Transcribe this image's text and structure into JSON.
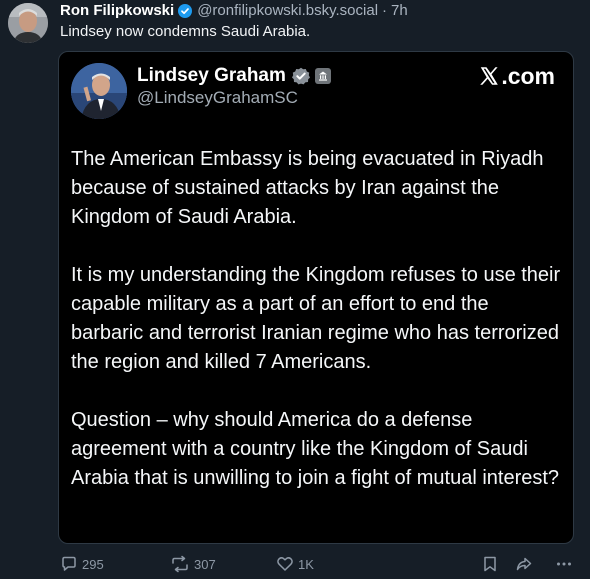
{
  "post": {
    "author_name": "Ron Filipkowski",
    "author_handle": "@ronfilipkowski.bsky.social",
    "separator": "·",
    "time": "7h",
    "text": "Lindsey now condemns Saudi Arabia."
  },
  "embed": {
    "name": "Lindsey Graham",
    "handle": "@LindseyGrahamSC",
    "source": ".com",
    "paragraphs": [
      "The American Embassy is being evacuated in Riyadh because of sustained attacks by Iran against the Kingdom of Saudi Arabia.",
      "It is my understanding the Kingdom refuses to use their capable military as a part of an effort to end the barbaric and terrorist Iranian regime who has terrorized the region and killed 7 Americans.",
      "Question – why should America do a defense agreement with a country like the Kingdom of Saudi Arabia that is unwilling to join a fight of mutual interest?"
    ]
  },
  "actions": {
    "replies": "295",
    "reposts": "307",
    "likes": "1K"
  },
  "icons": [
    "verified-icon",
    "government-badge-icon",
    "x-logo-icon",
    "reply-icon",
    "repost-icon",
    "like-icon",
    "bookmark-icon",
    "share-icon",
    "more-icon"
  ],
  "colors": {
    "background": "#161e27",
    "embed_background": "#000000",
    "verified": "#1d9bf0",
    "muted": "#8d98a5"
  }
}
